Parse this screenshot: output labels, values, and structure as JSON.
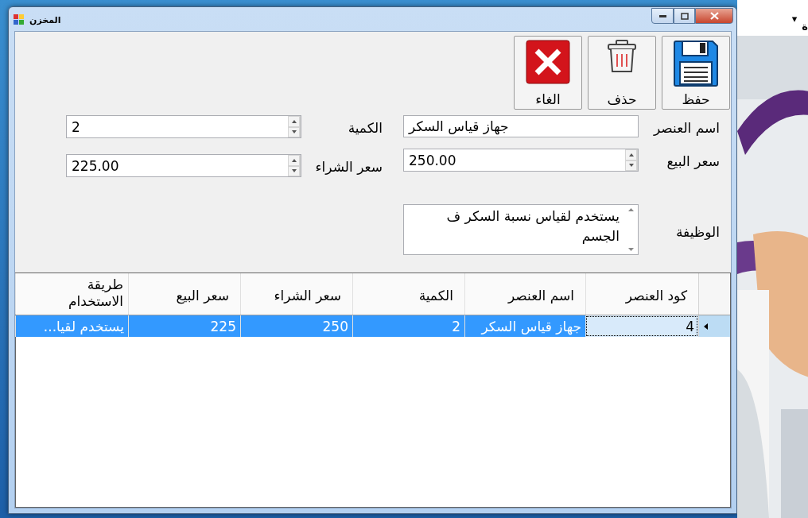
{
  "window": {
    "title": "المخزن"
  },
  "behind": {
    "menu_text": "ة",
    "dropdown_caret": "▾"
  },
  "toolbar": [
    {
      "kind": "save",
      "label": "حفظ"
    },
    {
      "kind": "delete",
      "label": "حذف"
    },
    {
      "kind": "cancel",
      "label": "الغاء"
    }
  ],
  "fields": [
    {
      "kind": "text",
      "label": "اسم العنصر",
      "value": "جهاز قياس السكر"
    },
    {
      "kind": "numeric",
      "label": "الكمية",
      "value": "2"
    },
    {
      "kind": "numeric",
      "label": "سعر البيع",
      "value": "250.00"
    },
    {
      "kind": "numeric",
      "label": "سعر الشراء",
      "value": "225.00"
    },
    {
      "kind": "multiline",
      "label": "الوظيفة",
      "value": "يستخدم لقياس نسبة السكر ف الجسم"
    }
  ],
  "grid": {
    "columns": [
      "كود العنصر",
      "اسم العنصر",
      "الكمية",
      "سعر الشراء",
      "سعر البيع",
      "طريقة الاستخدام"
    ],
    "rows": [
      {
        "selected": true,
        "cells": [
          {
            "text": "4",
            "focused": true
          },
          {
            "text": "جهاز قياس السكر",
            "focused": false
          },
          {
            "text": "2",
            "focused": false
          },
          {
            "text": "250",
            "focused": false
          },
          {
            "text": "225",
            "focused": false
          },
          {
            "text": "يستخدم لقيا...",
            "focused": false
          }
        ]
      }
    ]
  }
}
